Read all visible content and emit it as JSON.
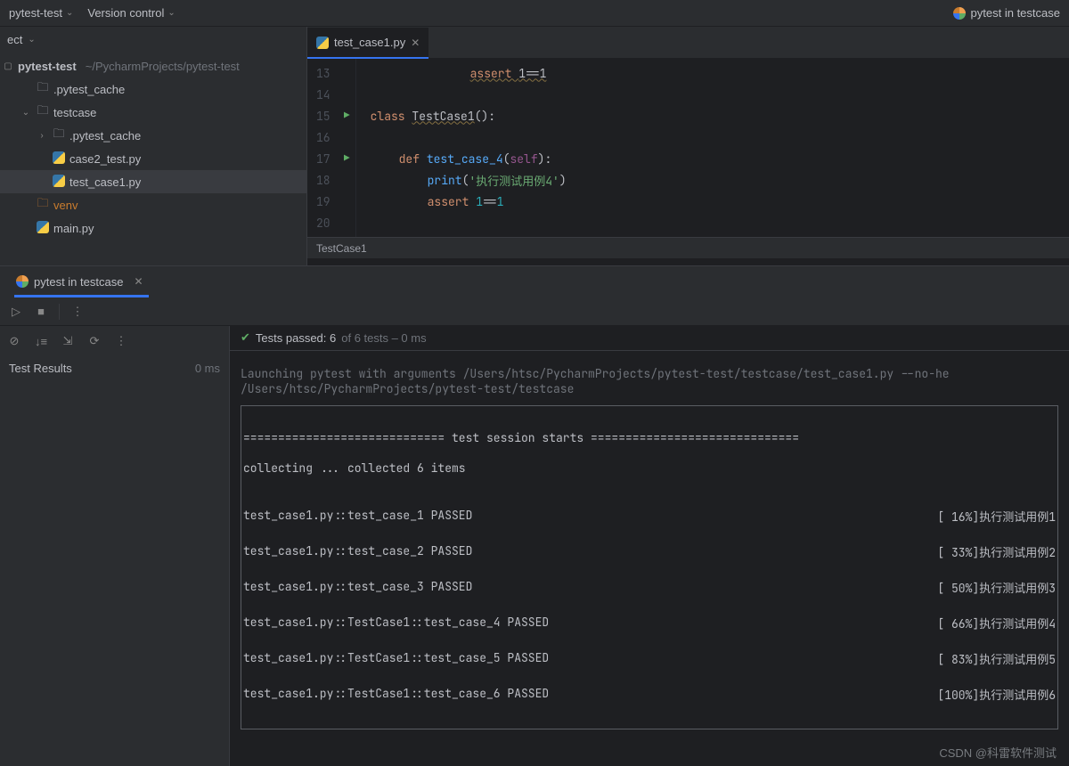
{
  "topbar": {
    "project_menu": "pytest-test",
    "vcs_menu": "Version control",
    "run_config": "pytest in testcase"
  },
  "project_dropdown": "ect",
  "tree": {
    "root": "pytest-test",
    "root_path": "~/PycharmProjects/pytest-test",
    "items": [
      {
        "indent": 1,
        "icon": "folder",
        "label": ".pytest_cache"
      },
      {
        "indent": 1,
        "icon": "folder",
        "label": "testcase",
        "chev": "v"
      },
      {
        "indent": 2,
        "icon": "folder",
        "label": ".pytest_cache",
        "chev": ">"
      },
      {
        "indent": 2,
        "icon": "py",
        "label": "case2_test.py"
      },
      {
        "indent": 2,
        "icon": "py",
        "label": "test_case1.py",
        "selected": true
      },
      {
        "indent": 1,
        "icon": "venv",
        "label": "venv"
      },
      {
        "indent": 1,
        "icon": "py",
        "label": "main.py"
      }
    ]
  },
  "editor": {
    "tab_name": "test_case1.py",
    "breadcrumb": "TestCase1",
    "lines": [
      {
        "n": "13",
        "run": false
      },
      {
        "n": "14",
        "run": false
      },
      {
        "n": "15",
        "run": true
      },
      {
        "n": "16",
        "run": false
      },
      {
        "n": "17",
        "run": true
      },
      {
        "n": "18",
        "run": false
      },
      {
        "n": "19",
        "run": false
      },
      {
        "n": "20",
        "run": false
      }
    ],
    "code": {
      "l13_assert": "assert ",
      "l13_expr": "1==1",
      "l15_class": "class ",
      "l15_name": "TestCase1",
      "l15_rest": "():",
      "l17_def": "def ",
      "l17_fn": "test_case_4",
      "l17_open": "(",
      "l17_self": "self",
      "l17_close": "):",
      "l18_print": "print",
      "l18_open": "(",
      "l18_str": "'执行测试用例4'",
      "l18_close": ")",
      "l19_assert": "assert ",
      "l19_a": "1",
      "l19_op": "==",
      "l19_b": "1"
    }
  },
  "run": {
    "tab": "pytest in testcase",
    "status_passed": "Tests passed: 6",
    "status_rest": " of 6 tests – 0 ms",
    "results_label": "Test Results",
    "results_time": "0 ms",
    "launch_line": "Launching pytest with arguments /Users/htsc/PycharmProjects/pytest-test/testcase/test_case1.py --no-he",
    "cwd_line": "/Users/htsc/PycharmProjects/pytest-test/testcase",
    "session_header": "============================= test session starts ==============================",
    "collecting": "collecting ... collected 6 items",
    "rows": [
      {
        "left": "test_case1.py::test_case_1 PASSED",
        "right": "[ 16%]执行测试用例1"
      },
      {
        "left": "test_case1.py::test_case_2 PASSED",
        "right": "[ 33%]执行测试用例2"
      },
      {
        "left": "test_case1.py::test_case_3 PASSED",
        "right": "[ 50%]执行测试用例3"
      },
      {
        "left": "test_case1.py::TestCase1::test_case_4 PASSED",
        "right": "[ 66%]执行测试用例4"
      },
      {
        "left": "test_case1.py::TestCase1::test_case_5 PASSED",
        "right": "[ 83%]执行测试用例5"
      },
      {
        "left": "test_case1.py::TestCase1::test_case_6 PASSED",
        "right": "[100%]执行测试用例6"
      }
    ]
  },
  "watermark": "CSDN @科雷软件测试"
}
